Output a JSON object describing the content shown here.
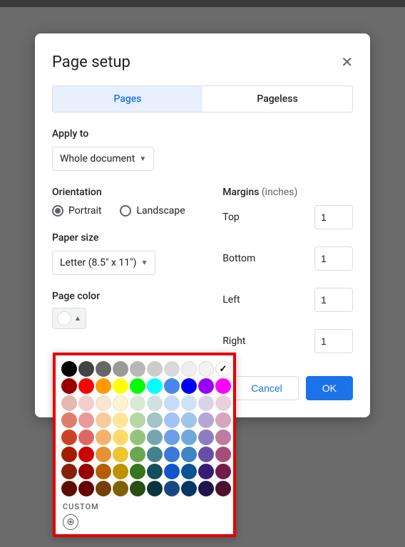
{
  "dialog": {
    "title": "Page setup",
    "tabs": {
      "pages": "Pages",
      "pageless": "Pageless"
    },
    "applyTo": {
      "label": "Apply to",
      "value": "Whole document"
    },
    "orientation": {
      "label": "Orientation",
      "portrait": "Portrait",
      "landscape": "Landscape",
      "selected": "portrait"
    },
    "paperSize": {
      "label": "Paper size",
      "value": "Letter (8.5\" x 11\")"
    },
    "pageColor": {
      "label": "Page color",
      "current": "#ffffff"
    },
    "margins": {
      "label": "Margins",
      "unit": "(inches)",
      "top": {
        "label": "Top",
        "value": "1"
      },
      "bottom": {
        "label": "Bottom",
        "value": "1"
      },
      "left": {
        "label": "Left",
        "value": "1"
      },
      "right": {
        "label": "Right",
        "value": "1"
      }
    },
    "footer": {
      "cancel": "Cancel",
      "ok": "OK"
    }
  },
  "colorPicker": {
    "customLabel": "CUSTOM",
    "selected": "#ffffff",
    "rows": [
      [
        "#000000",
        "#434343",
        "#666666",
        "#999999",
        "#b7b7b7",
        "#cccccc",
        "#d9d9d9",
        "#efefef",
        "#f3f3f3",
        "#ffffff"
      ],
      [
        "#980000",
        "#ff0000",
        "#ff9900",
        "#ffff00",
        "#00ff00",
        "#00ffff",
        "#4a86e8",
        "#0000ff",
        "#9900ff",
        "#ff00ff"
      ],
      [
        "#e6b8af",
        "#f4cccc",
        "#fce5cd",
        "#fff2cc",
        "#d9ead3",
        "#d0e0e3",
        "#c9daf8",
        "#cfe2f3",
        "#d9d2e9",
        "#ead1dc"
      ],
      [
        "#dd7e6b",
        "#ea9999",
        "#f9cb9c",
        "#ffe599",
        "#b6d7a8",
        "#a2c4c9",
        "#a4c2f4",
        "#9fc5e8",
        "#b4a7d6",
        "#d5a6bd"
      ],
      [
        "#cc4125",
        "#e06666",
        "#f6b26b",
        "#ffd966",
        "#93c47d",
        "#76a5af",
        "#6d9eeb",
        "#6fa8dc",
        "#8e7cc3",
        "#c27ba0"
      ],
      [
        "#a61c00",
        "#cc0000",
        "#e69138",
        "#f1c232",
        "#6aa84f",
        "#45818e",
        "#3c78d8",
        "#3d85c6",
        "#674ea7",
        "#a64d79"
      ],
      [
        "#85200c",
        "#990000",
        "#b45f06",
        "#bf9000",
        "#38761d",
        "#134f5c",
        "#1155cc",
        "#0b5394",
        "#351c75",
        "#741b47"
      ],
      [
        "#5b0f00",
        "#660000",
        "#783f04",
        "#7f6000",
        "#274e13",
        "#0c343d",
        "#1c4587",
        "#073763",
        "#20124d",
        "#4c1130"
      ]
    ]
  }
}
